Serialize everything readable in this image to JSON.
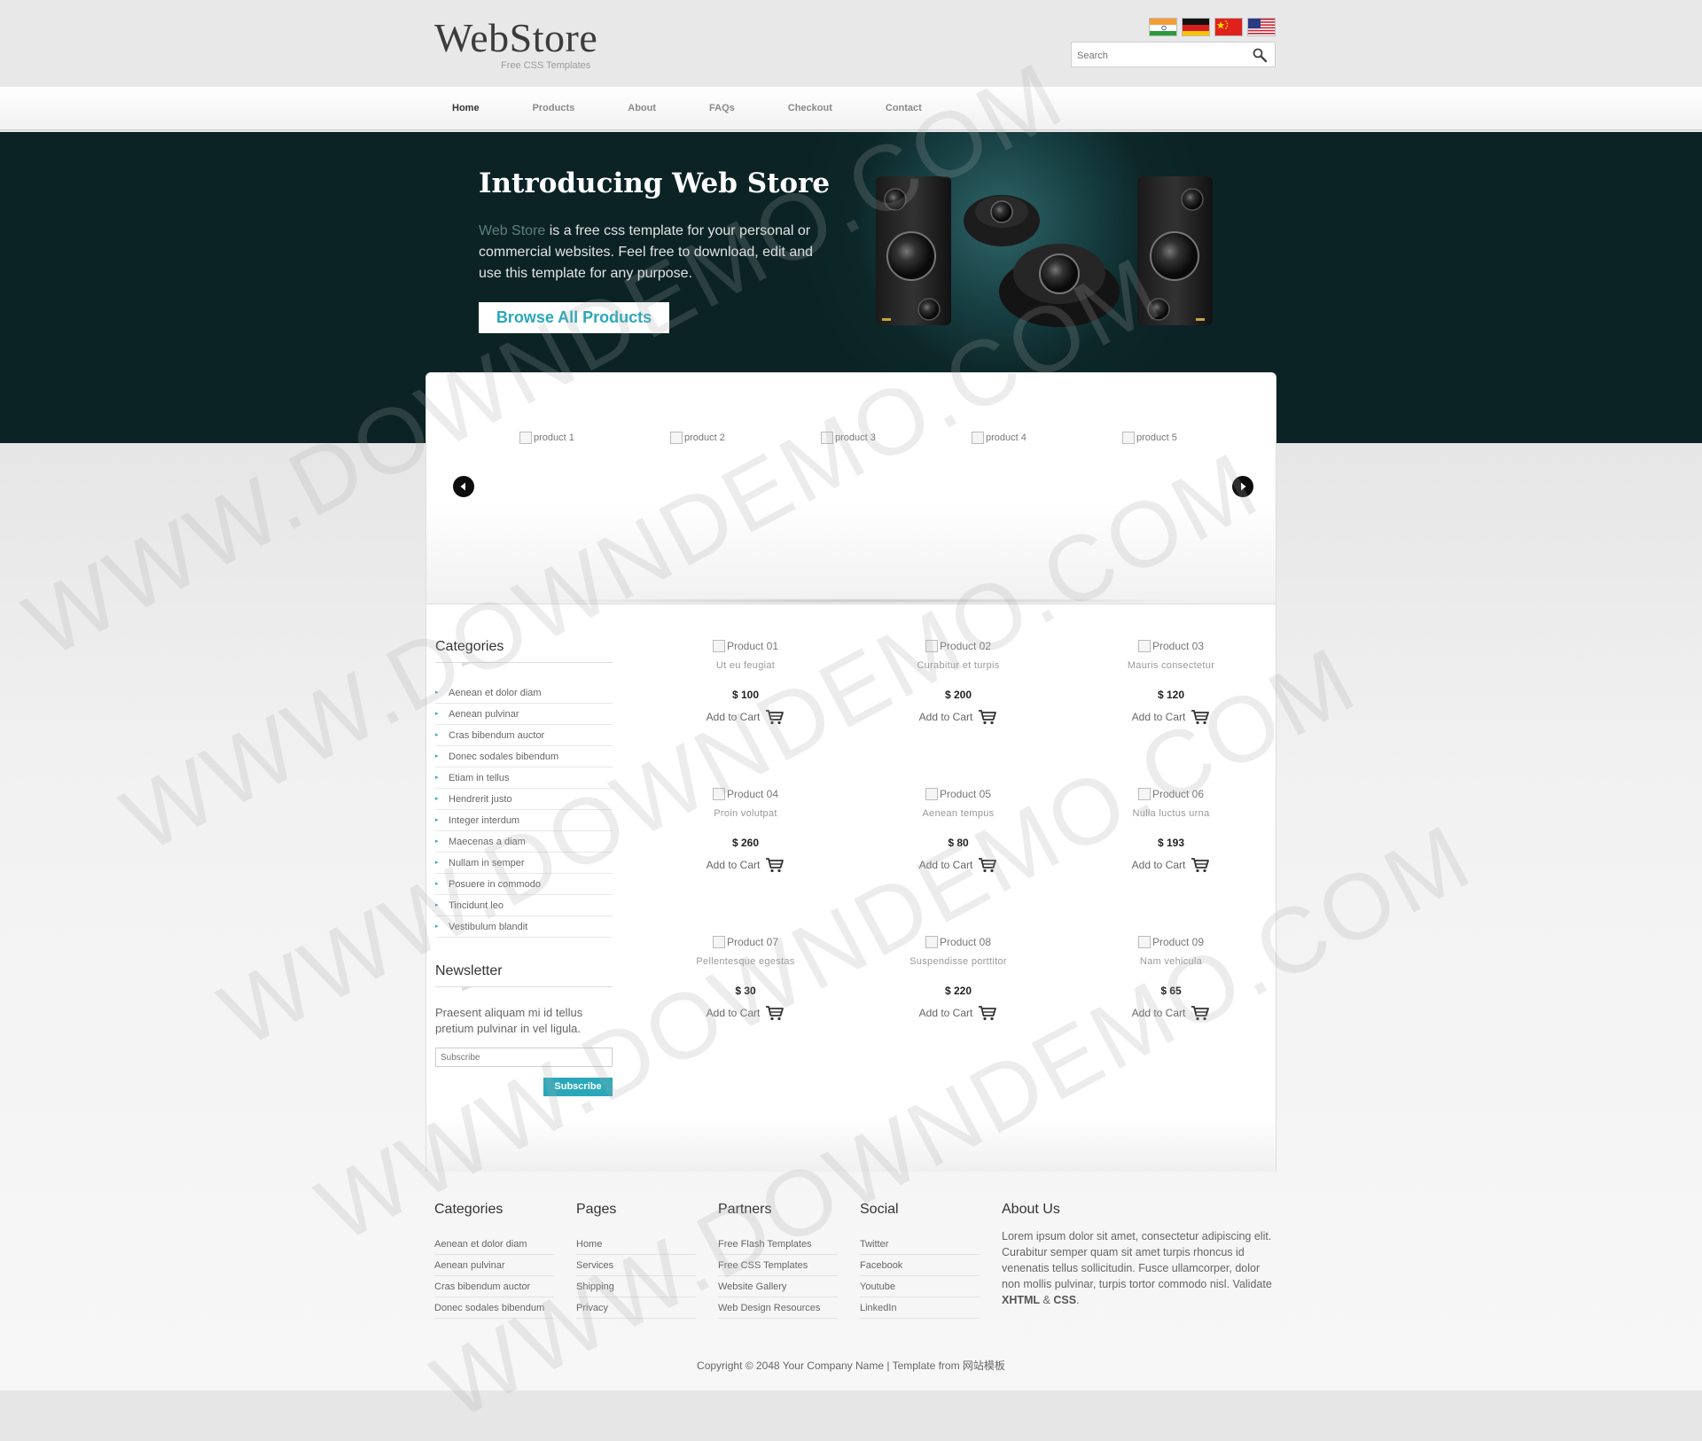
{
  "header": {
    "logo_title": "WebStore",
    "logo_subtitle": "Free CSS Templates",
    "search_placeholder": "Search",
    "flags": [
      "india-flag",
      "germany-flag",
      "china-flag",
      "usa-flag"
    ]
  },
  "nav": {
    "items": [
      {
        "label": "Home",
        "active": true
      },
      {
        "label": "Products"
      },
      {
        "label": "About"
      },
      {
        "label": "FAQs"
      },
      {
        "label": "Checkout"
      },
      {
        "label": "Contact"
      }
    ]
  },
  "banner": {
    "title": "Introducing Web Store",
    "text_highlight": "Web Store",
    "text_rest": " is a free css template for your personal or commercial websites. Feel free to download, edit and use this template for any purpose.",
    "button_label": "Browse All Products",
    "image": "speakers-image"
  },
  "slider": {
    "items": [
      "product 1",
      "product 2",
      "product 3",
      "product 4",
      "product 5"
    ],
    "prev_icon": "arrow-left-icon",
    "next_icon": "arrow-right-icon"
  },
  "sidebar": {
    "categories_title": "Categories",
    "categories": [
      "Aenean et dolor diam",
      "Aenean pulvinar",
      "Cras bibendum auctor",
      "Donec sodales bibendum",
      "Etiam in tellus",
      "Hendrerit justo",
      "Integer interdum",
      "Maecenas a diam",
      "Nullam in semper",
      "Posuere in commodo",
      "Tincidunt leo",
      "Vestibulum blandit"
    ],
    "newsletter_title": "Newsletter",
    "newsletter_text": "Praesent aliquam mi id tellus pretium pulvinar in vel ligula.",
    "subscribe_placeholder": "Subscribe",
    "subscribe_button": "Subscribe"
  },
  "products": [
    {
      "img_alt": "Product 01",
      "name": "Ut eu feugiat",
      "price": "$ 100",
      "cart": "Add to Cart"
    },
    {
      "img_alt": "Product 02",
      "name": "Curabitur et turpis",
      "price": "$ 200",
      "cart": "Add to Cart"
    },
    {
      "img_alt": "Product 03",
      "name": "Mauris consectetur",
      "price": "$ 120",
      "cart": "Add to Cart"
    },
    {
      "img_alt": "Product 04",
      "name": "Proin volutpat",
      "price": "$ 260",
      "cart": "Add to Cart"
    },
    {
      "img_alt": "Product 05",
      "name": "Aenean tempus",
      "price": "$ 80",
      "cart": "Add to Cart"
    },
    {
      "img_alt": "Product 06",
      "name": "Nulla luctus urna",
      "price": "$ 193",
      "cart": "Add to Cart"
    },
    {
      "img_alt": "Product 07",
      "name": "Pellentesque egestas",
      "price": "$ 30",
      "cart": "Add to Cart"
    },
    {
      "img_alt": "Product 08",
      "name": "Suspendisse porttitor",
      "price": "$ 220",
      "cart": "Add to Cart"
    },
    {
      "img_alt": "Product 09",
      "name": "Nam vehicula",
      "price": "$ 65",
      "cart": "Add to Cart"
    }
  ],
  "footer": {
    "categories": {
      "title": "Categories",
      "links": [
        "Aenean et dolor diam",
        "Aenean pulvinar",
        "Cras bibendum auctor",
        "Donec sodales bibendum"
      ]
    },
    "pages": {
      "title": "Pages",
      "links": [
        "Home",
        "Services",
        "Shipping",
        "Privacy"
      ]
    },
    "partners": {
      "title": "Partners",
      "links": [
        "Free Flash Templates",
        "Free CSS Templates",
        "Website Gallery",
        "Web Design Resources"
      ]
    },
    "social": {
      "title": "Social",
      "links": [
        "Twitter",
        "Facebook",
        "Youtube",
        "LinkedIn"
      ]
    },
    "about": {
      "title": "About Us",
      "text": "Lorem ipsum dolor sit amet, consectetur adipiscing elit. Curabitur semper quam sit amet turpis rhoncus id venenatis tellus sollicitudin. Fusce ullamcorper, dolor non mollis pulvinar, turpis tortor commodo nisl.",
      "validate_prefix": "Validate",
      "xhtml": "XHTML",
      "amp": "&",
      "css": "CSS"
    },
    "copyright": "Copyright © 2048 Your Company Name | Template from 网站模板"
  },
  "watermark": "WWW.DOWNDEMO.COM",
  "colors": {
    "accent": "#2aa8ba",
    "banner": "#0d2729",
    "background": "#e6e6e6"
  }
}
